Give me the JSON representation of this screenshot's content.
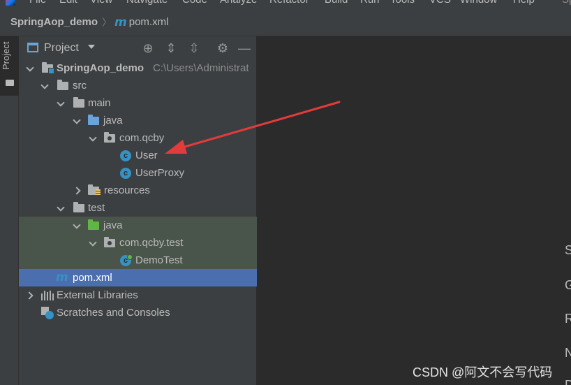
{
  "menubar": {
    "items": [
      "File",
      "Edit",
      "View",
      "Navigate",
      "Code",
      "Analyze",
      "Refactor",
      "Build",
      "Run",
      "Tools",
      "VCS",
      "Window",
      "Help"
    ],
    "right_text": "Sp"
  },
  "breadcrumb": {
    "project": "SpringAop_demo",
    "file": "pom.xml"
  },
  "toolstrip": {
    "project_tab": "Project"
  },
  "panel": {
    "title": "Project",
    "buttons": [
      "locate-icon",
      "expand-all-icon",
      "collapse-all-icon",
      "gear-icon",
      "minimize-icon"
    ]
  },
  "tree": {
    "root": {
      "label": "SpringAop_demo",
      "path": "C:\\Users\\Administrat"
    },
    "src": "src",
    "main": "main",
    "java": "java",
    "pkg": "com.qcby",
    "user": "User",
    "userproxy": "UserProxy",
    "resources": "resources",
    "test": "test",
    "test_java": "java",
    "test_pkg": "com.qcby.test",
    "demotest": "DemoTest",
    "pom": "pom.xml",
    "external": "External Libraries",
    "scratches": "Scratches and Consoles"
  },
  "editor": {
    "hints": [
      "S",
      "G",
      "R",
      "N",
      "D"
    ]
  },
  "watermark": "CSDN @阿文不会写代码",
  "colors": {
    "selection": "#4b6eaf",
    "test_background": "#49544a",
    "class_icon": "#3592c4",
    "annotation_arrow": "#e23b3b"
  }
}
